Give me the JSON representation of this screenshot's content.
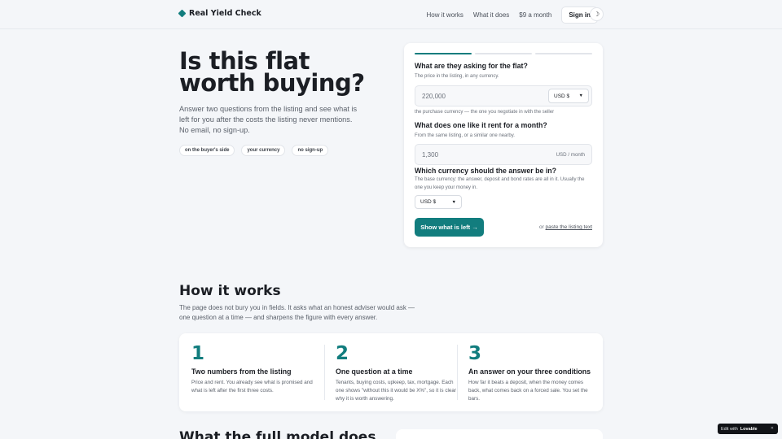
{
  "brand": {
    "name": "Real Yield Check"
  },
  "nav": {
    "items": [
      "How it works",
      "What it does",
      "$9 a month"
    ],
    "signin": "Sign in",
    "theme_icon": "☽"
  },
  "hero": {
    "title": "Is this flat worth buying?",
    "subtitle": "Answer two questions from the listing and see what is left for you after the costs the listing never mentions. No email, no sign-up.",
    "chips": [
      "on the buyer's side",
      "your currency",
      "no sign-up"
    ]
  },
  "form": {
    "progress": {
      "step": 1,
      "total": 3
    },
    "q1": {
      "label": "What are they asking for the flat?",
      "hint": "The price in the listing, in any currency.",
      "value": "220,000",
      "currency": "USD $",
      "note": "the purchase currency — the one you negotiate in with the seller"
    },
    "q2": {
      "label": "What does one like it rent for a month?",
      "hint": "From the same listing, or a similar one nearby.",
      "value": "1,300",
      "unit": "USD / month"
    },
    "q3": {
      "label": "Which currency should the answer be in?",
      "hint": "The base currency: the answer, deposit and bond rates are all in it. Usually the one you keep your money in.",
      "currency": "USD $"
    },
    "cta": "Show what is left →",
    "alt_prefix": "or",
    "alt_link": "paste the listing text"
  },
  "how": {
    "title": "How it works",
    "subtitle": "The page does not bury you in fields. It asks what an honest adviser would ask — one question at a time — and sharpens the figure with every answer.",
    "steps": [
      {
        "num": "1",
        "title": "Two numbers from the listing",
        "body": "Price and rent. You already see what is promised and what is left after the first three costs."
      },
      {
        "num": "2",
        "title": "One question at a time",
        "body": "Tenants, buying costs, upkeep, tax, mortgage. Each one shows \"without this it would be X%\", so it is clear why it is worth answering."
      },
      {
        "num": "3",
        "title": "An answer on your three conditions",
        "body": "How far it beats a deposit, when the money comes back, what comes back on a forced sale. You set the bars."
      }
    ]
  },
  "next_section": {
    "title": "What the full model does"
  },
  "badge": {
    "prefix": "Edit with",
    "name": "Lovable",
    "close": "✕"
  }
}
